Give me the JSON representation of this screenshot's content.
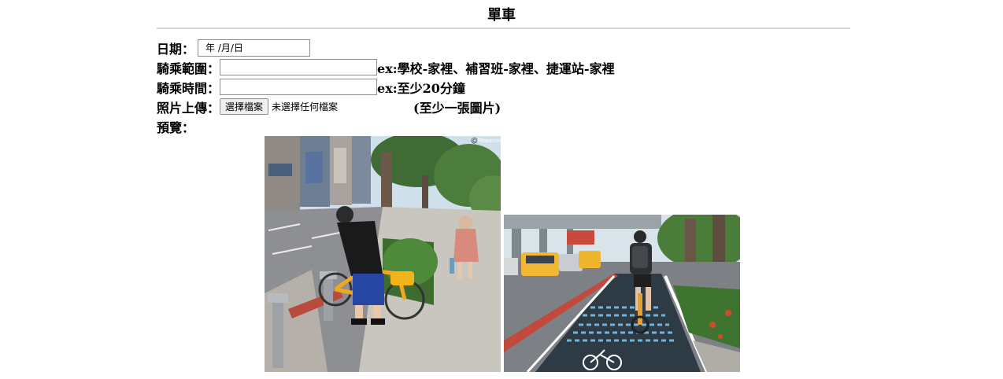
{
  "page": {
    "title": "單車"
  },
  "form": {
    "date": {
      "label": "日期：",
      "placeholder": "年 /月/日"
    },
    "range": {
      "label": "騎乘範圍：",
      "value": "",
      "hint": "ex:學校-家裡、補習班-家裡、捷運站-家裡"
    },
    "time": {
      "label": "騎乘時間：",
      "value": "",
      "hint": "ex:至少20分鐘"
    },
    "upload": {
      "label": "照片上傳：",
      "button_label": "選擇檔案",
      "status": "未選擇任何檔案",
      "note": "(至少一張圖片)"
    },
    "preview": {
      "label": "預覽："
    }
  },
  "photos": [
    {
      "icon": "bike-station-photo",
      "watermark": "©️Mosanna"
    },
    {
      "icon": "bike-lane-photo"
    }
  ]
}
